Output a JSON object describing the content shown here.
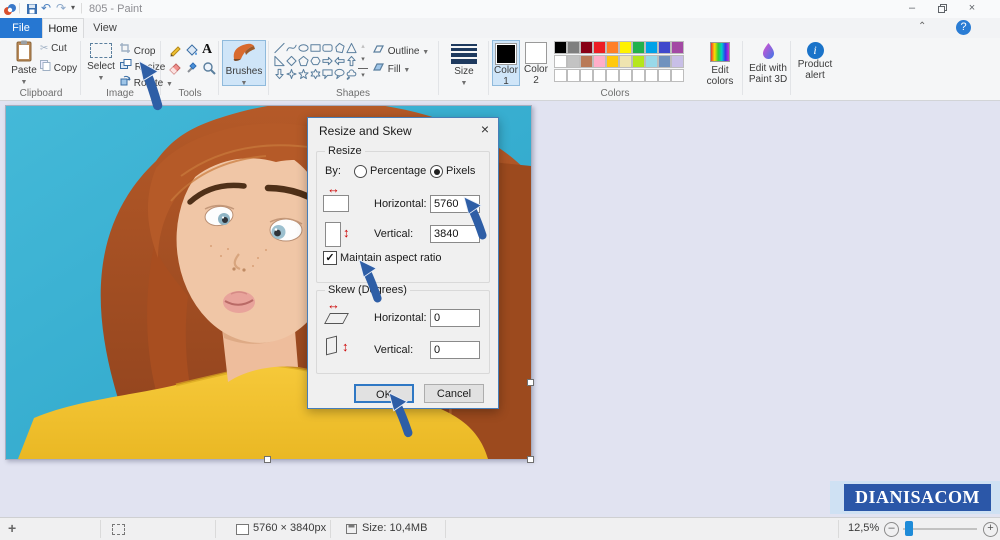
{
  "window": {
    "title": "805 - Paint"
  },
  "tabs": {
    "file": "File",
    "home": "Home",
    "view": "View"
  },
  "ribbon": {
    "clipboard": {
      "group_label": "Clipboard",
      "paste_label": "Paste",
      "cut_label": "Cut",
      "copy_label": "Copy"
    },
    "image": {
      "group_label": "Image",
      "select_label": "Select",
      "crop_label": "Crop",
      "resize_label": "Resize",
      "rotate_label": "Rotate"
    },
    "tools": {
      "group_label": "Tools",
      "items": [
        "pencil",
        "fill-with-color",
        "text",
        "eraser",
        "color-picker",
        "magnifier"
      ]
    },
    "brushes": {
      "label": "Brushes"
    },
    "shapes": {
      "group_label": "Shapes",
      "outline_label": "Outline",
      "fill_label": "Fill",
      "items": [
        "line",
        "curve",
        "oval",
        "rectangle",
        "rounded-rectangle",
        "polygon",
        "triangle",
        "right-triangle",
        "diamond",
        "pentagon",
        "hexagon",
        "arrow-right",
        "arrow-left",
        "arrow-up",
        "arrow-down",
        "four-point-star",
        "five-point-star",
        "six-point-star",
        "rectangular-callout",
        "oval-callout",
        "cloud-callout"
      ]
    },
    "size": {
      "label": "Size"
    },
    "colors": {
      "group_label": "Colors",
      "color1": [
        "Color",
        "1"
      ],
      "color2": [
        "Color",
        "2"
      ],
      "edit_colors": [
        "Edit",
        "colors"
      ]
    },
    "paint3d": [
      "Edit with",
      "Paint 3D"
    ],
    "product_alert": [
      "Product",
      "alert"
    ]
  },
  "palette": {
    "row1": [
      "#000000",
      "#7f7f7f",
      "#880015",
      "#ed1c24",
      "#ff7f27",
      "#fff200",
      "#22b14c",
      "#00a2e8",
      "#3f48cc",
      "#a349a4"
    ],
    "row2": [
      "#ffffff",
      "#c3c3c3",
      "#b97a57",
      "#ffaec9",
      "#ffc90e",
      "#efe4b0",
      "#b5e61d",
      "#99d9ea",
      "#7092be",
      "#c8bfe7"
    ],
    "row3": [
      "#ffffff",
      "#ffffff",
      "#ffffff",
      "#ffffff",
      "#ffffff",
      "#ffffff",
      "#ffffff",
      "#ffffff",
      "#ffffff",
      "#ffffff"
    ]
  },
  "dialog": {
    "title": "Resize and Skew",
    "close_glyph": "×",
    "resize": {
      "section_label": "Resize",
      "by_label": "By:",
      "percentage_label": "Percentage",
      "pixels_label": "Pixels",
      "selected_unit": "Pixels",
      "horizontal_label": "Horizontal:",
      "horizontal_value": "5760",
      "vertical_label": "Vertical:",
      "vertical_value": "3840",
      "maintain_label": "Maintain aspect ratio",
      "maintain_checked": true,
      "check_glyph": "✓"
    },
    "skew": {
      "section_label": "Skew (Degrees)",
      "horizontal_label": "Horizontal:",
      "horizontal_value": "0",
      "vertical_label": "Vertical:",
      "vertical_value": "0"
    },
    "ok_label": "OK",
    "cancel_label": "Cancel"
  },
  "status_bar": {
    "canvas_dimensions": "5760 × 3840px",
    "file_size": "Size: 10,4MB",
    "zoom_level": "12,5%"
  },
  "watermark": {
    "text": "DIANISACOM"
  },
  "theme": {
    "accent": "#2677d2",
    "annotation_arrow": "#2e5ea6",
    "canvas_teal": "#3ab3d4",
    "selected_button_bg": "#cfe5f8",
    "watermark_bg": "#2b57a8",
    "file_tab_bg": "#2677d2"
  }
}
